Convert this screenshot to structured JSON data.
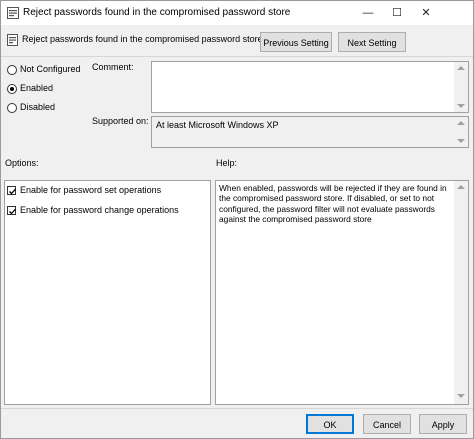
{
  "window": {
    "title": "Reject passwords found in the compromised password store",
    "minimize_glyph": "—",
    "maximize_glyph": "☐",
    "close_glyph": "✕"
  },
  "header": {
    "setting_name": "Reject passwords found in the compromised password store",
    "previous_label": "Previous Setting",
    "next_label": "Next Setting"
  },
  "state": {
    "options": [
      "Not Configured",
      "Enabled",
      "Disabled"
    ],
    "selected": "Enabled"
  },
  "comment": {
    "label": "Comment:",
    "value": ""
  },
  "supported": {
    "label": "Supported on:",
    "value": "At least Microsoft Windows XP"
  },
  "options_panel": {
    "label": "Options:",
    "items": [
      {
        "label": "Enable for password set operations",
        "checked": true
      },
      {
        "label": "Enable for password change operations",
        "checked": true
      }
    ]
  },
  "help_panel": {
    "label": "Help:",
    "text": "When enabled, passwords will be rejected if they are found in the compromised password store. If disabled, or set to not configured, the password filter will not evaluate passwords against the compromised password store"
  },
  "footer": {
    "ok_label": "OK",
    "cancel_label": "Cancel",
    "apply_label": "Apply"
  },
  "colors": {
    "accent": "#0078d7",
    "dialog_bg": "#f0f0f0"
  }
}
